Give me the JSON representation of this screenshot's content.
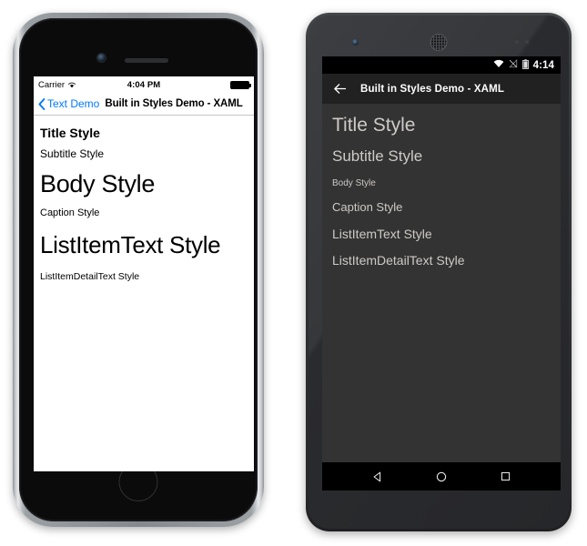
{
  "page": {
    "title": "Built in Styles Demo - XAML",
    "description": "Side-by-side iOS and Android device screenshots of a Xamarin.Forms built-in text styles demo"
  },
  "ios": {
    "device_name": "iPhone",
    "status_bar": {
      "carrier": "Carrier",
      "wifi_icon": "wifi-icon",
      "time": "4:04 PM",
      "battery_icon": "battery-full-icon"
    },
    "nav_bar": {
      "back_icon": "chevron-left-icon",
      "back_label": "Text Demo",
      "title": "Built in Styles Demo - XAML"
    },
    "styles": [
      {
        "key": "title",
        "label": "Title Style"
      },
      {
        "key": "subtitle",
        "label": "Subtitle Style"
      },
      {
        "key": "body",
        "label": "Body Style"
      },
      {
        "key": "caption",
        "label": "Caption Style"
      },
      {
        "key": "listitemtext",
        "label": "ListItemText Style"
      },
      {
        "key": "listitemdetail",
        "label": "ListItemDetailText Style"
      }
    ],
    "hardware": {
      "camera": "front-camera",
      "speaker": "earpiece-speaker",
      "home_button": "home-button"
    },
    "colors": {
      "accent": "#007AFF",
      "background": "#FFFFFF",
      "text": "#000000",
      "nav_separator": "#C4C4C6"
    }
  },
  "android": {
    "device_name": "Android phone",
    "status_bar": {
      "wifi_icon": "wifi-icon",
      "signal_icon": "signal-off-icon",
      "battery_icon": "battery-icon",
      "time": "4:14"
    },
    "action_bar": {
      "back_icon": "arrow-left-icon",
      "title": "Built in Styles Demo - XAML"
    },
    "styles": [
      {
        "key": "title",
        "label": "Title Style"
      },
      {
        "key": "subtitle",
        "label": "Subtitle Style"
      },
      {
        "key": "body",
        "label": "Body Style"
      },
      {
        "key": "caption",
        "label": "Caption Style"
      },
      {
        "key": "listitemtext",
        "label": "ListItemText Style"
      },
      {
        "key": "listitemdetail",
        "label": "ListItemDetailText Style"
      }
    ],
    "nav_bar": {
      "back_icon": "nav-back-triangle-icon",
      "home_icon": "nav-home-circle-icon",
      "recents_icon": "nav-recents-square-icon"
    },
    "hardware": {
      "camera": "front-camera",
      "speaker": "earpiece-speaker",
      "sensors": "proximity-sensors"
    },
    "colors": {
      "screen_background": "#333333",
      "action_bar": "#212121",
      "status_bar": "#000000",
      "text": "#CDCAC7"
    }
  }
}
